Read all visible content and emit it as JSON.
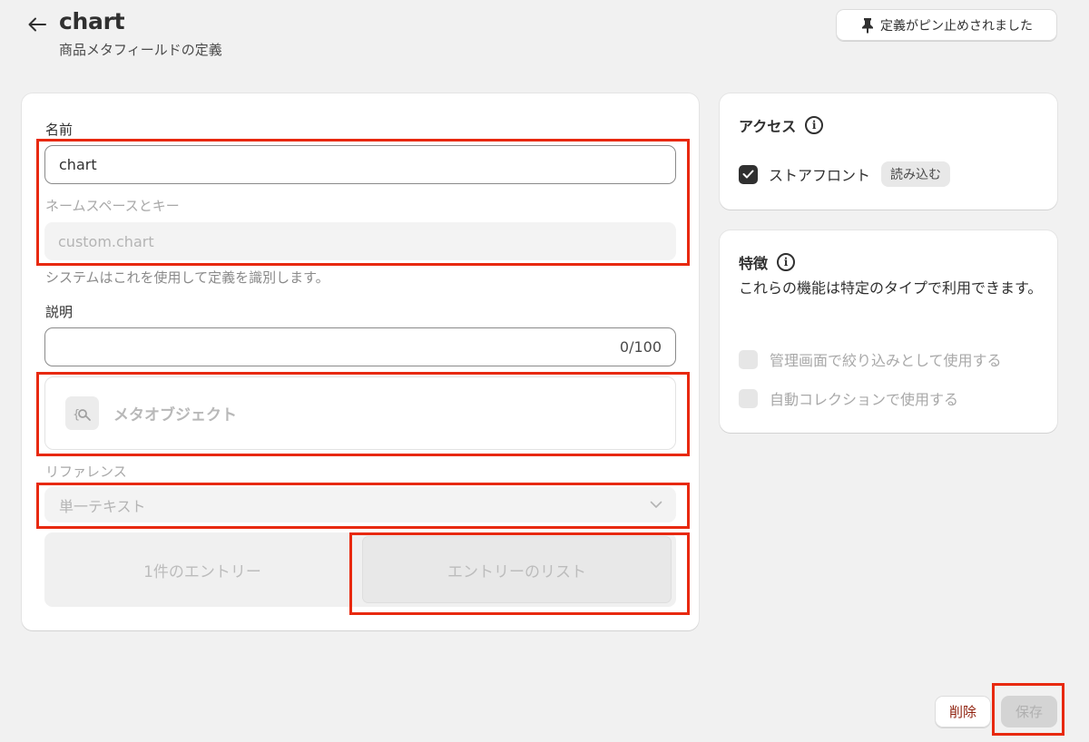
{
  "header": {
    "title": "chart",
    "subtitle": "商品メタフィールドの定義",
    "pin_label": "定義がピン止めされました"
  },
  "form": {
    "name_label": "名前",
    "name_value": "chart",
    "namespace_label": "ネームスペースとキー",
    "namespace_value": "custom.chart",
    "namespace_hint": "システムはこれを使用して定義を識別します。",
    "description_label": "説明",
    "description_value": "",
    "description_counter": "0/100",
    "metaobject_label": "メタオブジェクト",
    "reference_label": "リファレンス",
    "type_value": "単一テキスト",
    "toggle_single": "1件のエントリー",
    "toggle_list": "エントリーのリスト"
  },
  "access": {
    "title": "アクセス",
    "storefront_label": "ストアフロント",
    "storefront_checked": true,
    "storefront_badge": "読み込む"
  },
  "features": {
    "title": "特徴",
    "description": "これらの機能は特定のタイプで利用できます。",
    "options": [
      {
        "label": "管理画面で絞り込みとして使用する",
        "checked": false
      },
      {
        "label": "自動コレクションで使用する",
        "checked": false
      }
    ]
  },
  "footer": {
    "delete_label": "削除",
    "save_label": "保存"
  },
  "colors": {
    "highlight": "#e8290f",
    "delete_text": "#8e1f0b",
    "background": "#f1f1f1"
  }
}
